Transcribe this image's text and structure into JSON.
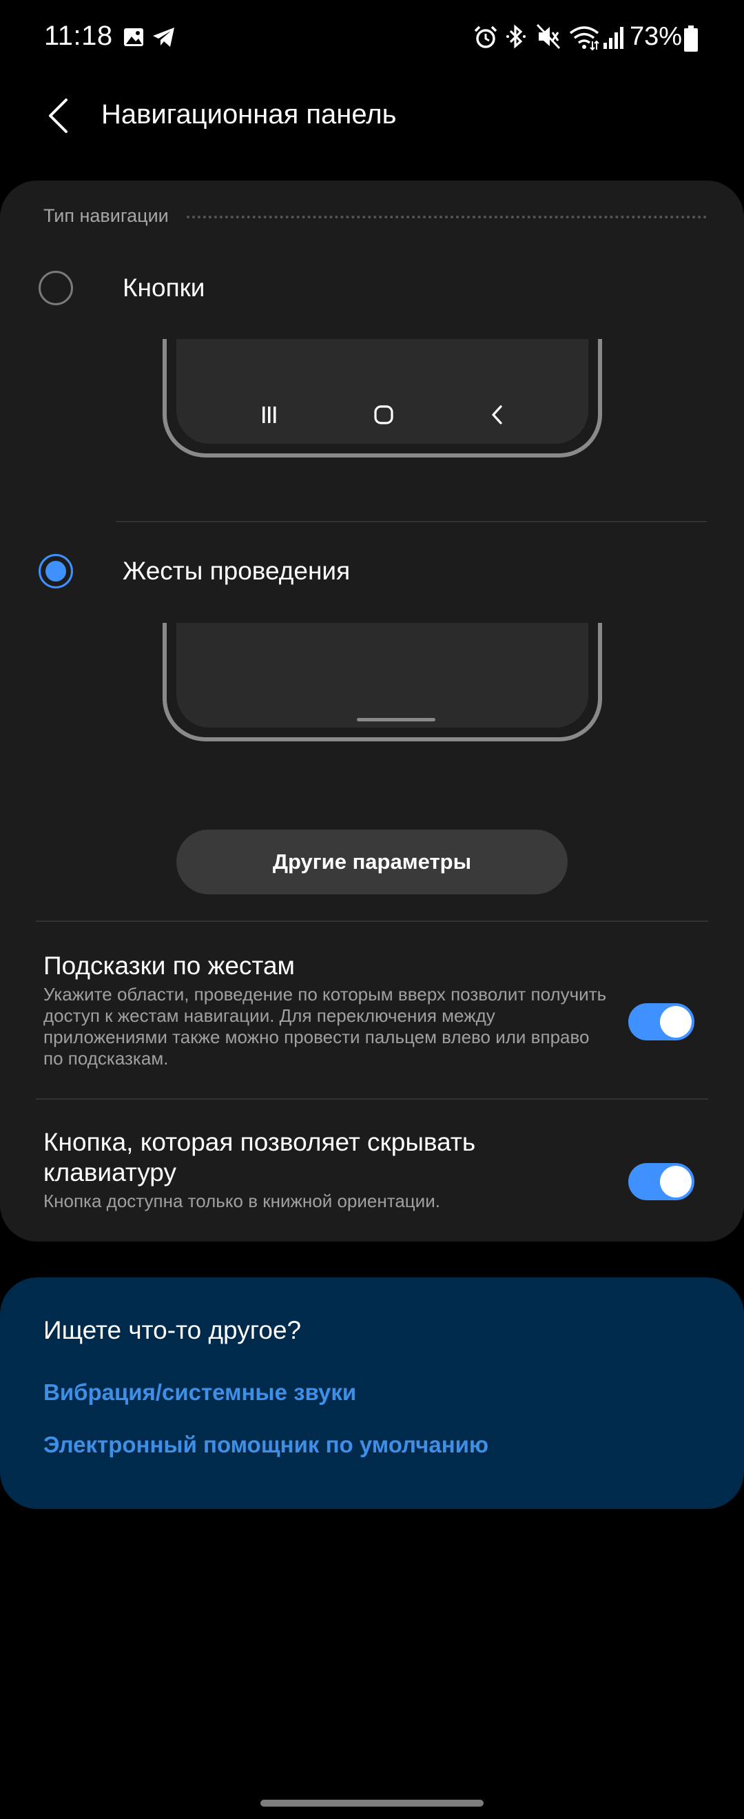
{
  "status_bar": {
    "time": "11:18",
    "battery_percent": "73%",
    "icons": [
      "gallery-icon",
      "telegram-icon",
      "alarm-icon",
      "bluetooth-icon",
      "mute-icon",
      "wifi-icon",
      "signal-icon",
      "battery-icon"
    ]
  },
  "header": {
    "title": "Навигационная панель",
    "back_icon": "chevron-left-icon"
  },
  "navigation_type": {
    "section_label": "Тип навигации",
    "options": [
      {
        "label": "Кнопки",
        "selected": false,
        "preview_icons": [
          "recents-icon",
          "home-icon",
          "back-icon"
        ]
      },
      {
        "label": "Жесты проведения",
        "selected": true
      }
    ]
  },
  "more_options": {
    "label": "Другие параметры"
  },
  "settings": [
    {
      "title": "Подсказки по жестам",
      "description": "Укажите области, проведение по которым вверх позволит получить доступ к жестам навигации. Для переключения между приложениями также можно провести пальцем влево или вправо по подсказкам.",
      "enabled": true
    },
    {
      "title": "Кнопка, которая позволяет скрывать клавиатуру",
      "description": "Кнопка доступна только в книжной ориентации.",
      "enabled": true
    }
  ],
  "suggestions": {
    "title": "Ищете что-то другое?",
    "links": [
      "Вибрация/системные звуки",
      "Электронный помощник по умолчанию"
    ]
  },
  "colors": {
    "accent": "#3e91ff",
    "card_background": "#1c1c1c",
    "suggest_background": "#002a4c",
    "link": "#3f8fe8"
  }
}
